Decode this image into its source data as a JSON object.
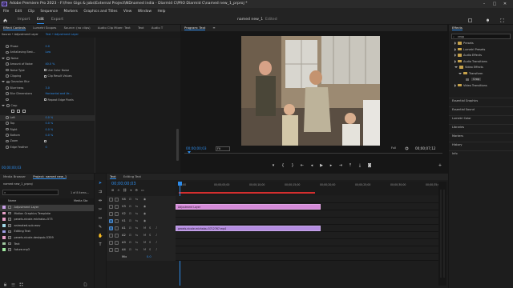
{
  "window": {
    "title": "Adobe Premiere Pro 2023 - F:\\Free Gigs & jobs\\External Project\\NDnamed india - Diarmid C\\PRO Diarmid C\\named new_1_prproj *",
    "logo_text": "Pr",
    "minimize": "–",
    "maximize": "□",
    "close": "✕"
  },
  "menu": [
    "File",
    "Edit",
    "Clip",
    "Sequence",
    "Markers",
    "Graphics and Titles",
    "View",
    "Window",
    "Help"
  ],
  "workspace": {
    "home_icon": "home-icon",
    "tabs": [
      "Import",
      "Edit",
      "Export"
    ],
    "active_tab": "Edit",
    "document": "named new_1",
    "document_status": "Edited"
  },
  "effect_controls": {
    "tabs": [
      "Effect Controls",
      "Lumetri Scopes",
      "Source: (no clips)",
      "Audio Clip Mixer: Text",
      "Text",
      "Audio T"
    ],
    "subheader": "Source • Adjustment Layer",
    "subheader2": "Text • Adjustment Layer",
    "rows": [
      {
        "label": "Phase",
        "value": "0.0",
        "kind": "param"
      },
      {
        "label": "Antialiasing Best...",
        "value": "Low",
        "kind": "param"
      },
      {
        "label": "Noise",
        "value": "",
        "kind": "section"
      },
      {
        "label": "Amount of Noise",
        "value": "40.0 %",
        "kind": "param"
      },
      {
        "label": "Noise Type",
        "value": "Use Color Noise",
        "kind": "check"
      },
      {
        "label": "Clipping",
        "value": "Clip Result Values",
        "kind": "check"
      },
      {
        "label": "Gaussian Blur",
        "value": "",
        "kind": "section"
      },
      {
        "label": "Blurriness",
        "value": "3.0",
        "kind": "param"
      },
      {
        "label": "Blur Dimensions",
        "value": "Horizontal and Ve...",
        "kind": "param"
      },
      {
        "label": "",
        "value": "Repeat Edge Pixels",
        "kind": "check"
      },
      {
        "label": "Crop",
        "value": "",
        "kind": "section"
      },
      {
        "label": "",
        "value": "",
        "kind": "shapes"
      },
      {
        "label": "Left",
        "value": "0.0 %",
        "kind": "param"
      },
      {
        "label": "Top",
        "value": "0.0 %",
        "kind": "param"
      },
      {
        "label": "Right",
        "value": "0.0 %",
        "kind": "param"
      },
      {
        "label": "Bottom",
        "value": "0.0 %",
        "kind": "param"
      },
      {
        "label": "Zoom",
        "value": "",
        "kind": "check"
      },
      {
        "label": "Edge Feather",
        "value": "0",
        "kind": "param"
      }
    ],
    "timecode": "00;00;00;03"
  },
  "program_monitor": {
    "tab": "Program: Text",
    "menu_icon": "hamburger-icon",
    "timecode": "00;00;00;03",
    "fit": "Fit",
    "quality": "Full",
    "duration": "00;00;07;12"
  },
  "project_panel": {
    "tabs": [
      "Media Browser",
      "Project: named new_1"
    ],
    "file": "named new_1_prproj",
    "item_count": "1 of 8 items...",
    "col_name": "Name",
    "col_rate": "Media Sta",
    "items": [
      {
        "name": "Adjustment Layer",
        "color": "#c9a0e8",
        "selected": true
      },
      {
        "name": "Motion Graphics Template",
        "color": "#e8a0c8",
        "selected": false
      },
      {
        "name": "pexels-nicole-michalou-573",
        "color": "#e8a0c8",
        "selected": false
      },
      {
        "name": "animated-sub.mov",
        "color": "#a0d8e8",
        "selected": false
      },
      {
        "name": "Editing Text",
        "color": "#a0a0e8",
        "selected": false
      },
      {
        "name": "pexels-nicole-deskpub-5359",
        "color": "#e8a0c8",
        "selected": false
      },
      {
        "name": "Text",
        "color": "#a0c8a0",
        "selected": false
      },
      {
        "name": "future.mp3",
        "color": "#a0e8a0",
        "selected": false
      }
    ]
  },
  "timeline": {
    "tabs": [
      "Text",
      "Editing Text"
    ],
    "timecode": "00;00;00;03",
    "ruler": [
      "00;00",
      "00;00;05;00",
      "00;00;10;00",
      "00;00;15;00",
      "00;00;20;00",
      "00;00;25;00",
      "00;00;30;00",
      "00;00;35;00"
    ],
    "tracks": [
      {
        "label": "V4"
      },
      {
        "label": "V3"
      },
      {
        "label": "V2"
      },
      {
        "label": "V1"
      },
      {
        "label": "A1"
      },
      {
        "label": "A2"
      },
      {
        "label": "A3"
      },
      {
        "label": "A4"
      },
      {
        "label": "Mix",
        "value": "0.0"
      }
    ],
    "clips": [
      {
        "name": "Adjustment Layer",
        "color": "#d48ad8"
      },
      {
        "name": "pexels-nicole-michalou-5712767.mp4",
        "color": "#b48de0"
      }
    ]
  },
  "effects_panel": {
    "tab": "Effects",
    "search_value": "crop",
    "tree": [
      {
        "label": "Presets",
        "level": 1,
        "kind": "folder"
      },
      {
        "label": "Lumetri Presets",
        "level": 1,
        "kind": "folder"
      },
      {
        "label": "Audio Effects",
        "level": 1,
        "kind": "folder"
      },
      {
        "label": "Audio Transitions",
        "level": 1,
        "kind": "folder"
      },
      {
        "label": "Video Effects",
        "level": 1,
        "kind": "folder"
      },
      {
        "label": "Transform",
        "level": 2,
        "kind": "folder"
      },
      {
        "label": "Crop",
        "level": 3,
        "kind": "effect"
      },
      {
        "label": "Video Transitions",
        "level": 1,
        "kind": "folder"
      }
    ],
    "sections": [
      "Essential Graphics",
      "Essential Sound",
      "Lumetri Color",
      "Libraries",
      "Markers",
      "History",
      "Info"
    ]
  }
}
